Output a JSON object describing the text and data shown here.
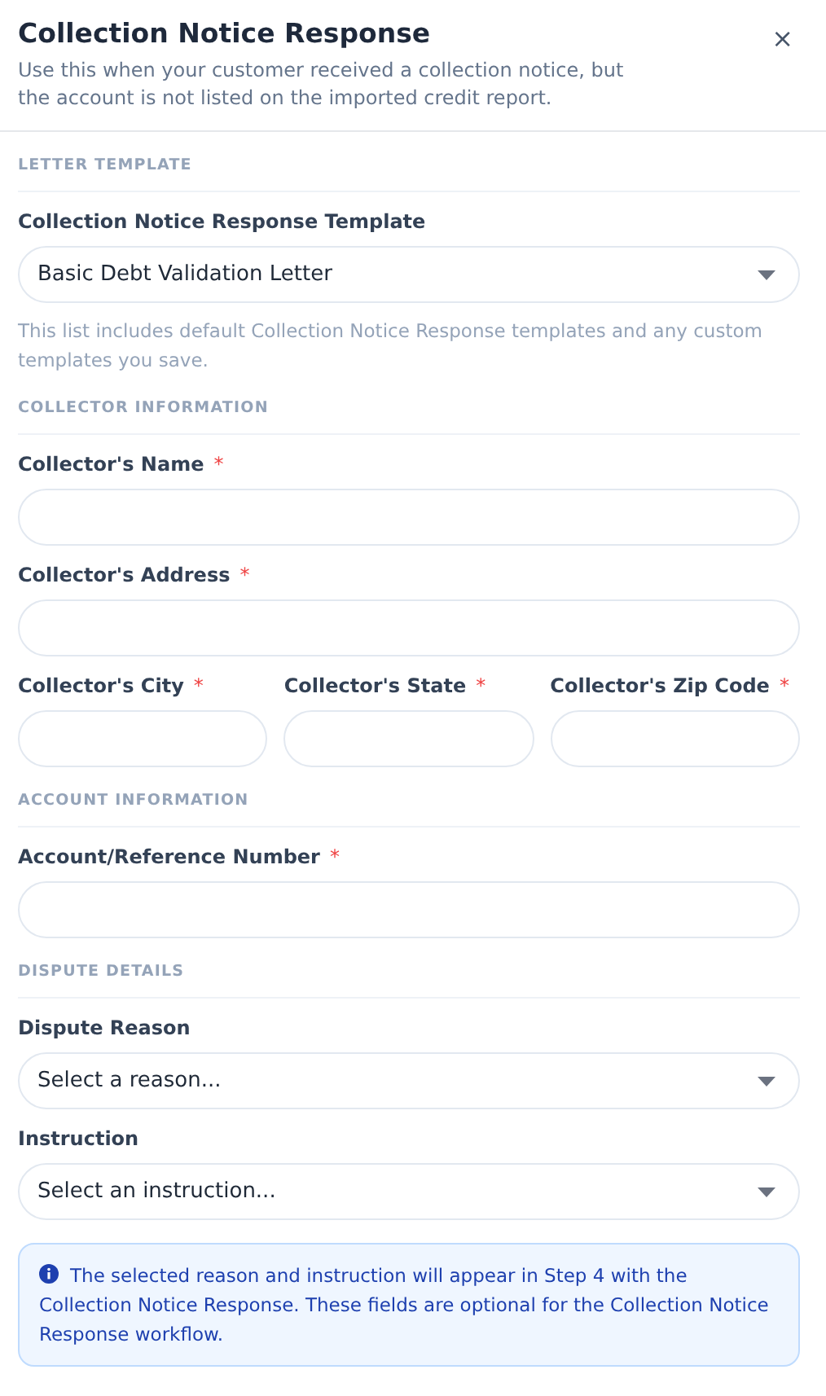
{
  "header": {
    "title": "Collection Notice Response",
    "subtitle": "Use this when your customer received a collection notice, but\nthe account is not listed on the imported credit report.",
    "close": "×"
  },
  "sections": [
    {
      "heading": "LETTER TEMPLATE",
      "rows": [
        [
          {
            "kind": "select",
            "label": "Collection Notice Response Template",
            "value": "Basic Debt Validation Letter"
          }
        ]
      ],
      "help": "This list includes default Collection Notice Response templates and any custom templates you save."
    },
    {
      "heading": "COLLECTOR INFORMATION",
      "rows": [
        [
          {
            "kind": "text",
            "label": "Collector's Name",
            "mark": "*"
          }
        ],
        [
          {
            "kind": "text",
            "label": "Collector's Address",
            "mark": "*"
          }
        ],
        [
          {
            "kind": "text",
            "label": "Collector's City",
            "mark": "*"
          },
          {
            "kind": "text",
            "label": "Collector's State",
            "mark": "*"
          },
          {
            "kind": "text",
            "label": "Collector's Zip Code",
            "mark": "*"
          }
        ]
      ]
    },
    {
      "heading": "ACCOUNT INFORMATION",
      "rows": [
        [
          {
            "kind": "text",
            "label": "Account/Reference Number",
            "mark": "*"
          }
        ]
      ]
    },
    {
      "heading": "DISPUTE DETAILS",
      "rows": [
        [
          {
            "kind": "select",
            "label": "Dispute Reason",
            "value": "Select a reason..."
          }
        ],
        [
          {
            "kind": "select",
            "label": "Instruction",
            "value": "Select an instruction..."
          }
        ]
      ]
    }
  ],
  "notice": {
    "text": "The selected reason and instruction will appear in Step 4 with the Collection Notice Response. These fields are optional for the Collection Notice Response workflow."
  }
}
